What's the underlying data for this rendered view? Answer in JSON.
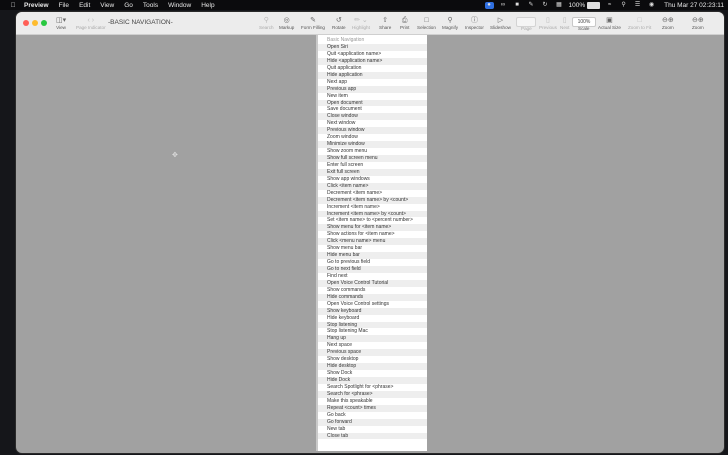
{
  "menubar": {
    "app_name": "Preview",
    "items": [
      "File",
      "Edit",
      "View",
      "Go",
      "Tools",
      "Window",
      "Help"
    ],
    "battery_percent": "100%",
    "datetime": "Thu Mar 27  02:23:11"
  },
  "window": {
    "doc_title": "-BASIC NAVIGATION-",
    "toolbar": {
      "view": "View",
      "page_indicator": "Page Indicator",
      "search": "Search",
      "markup": "Markup",
      "form_filling": "Form Filling",
      "rotate": "Rotate",
      "highlight": "Highlight",
      "share": "Share",
      "print": "Print",
      "selection": "Selection",
      "magnify": "Magnify",
      "inspector": "Inspector",
      "slideshow": "Slideshow",
      "page": "Page",
      "previous": "Previous",
      "next": "Next",
      "scale": "Scale",
      "zoom_value": "100%",
      "actual_size": "Actual Size",
      "zoom_to_fit": "Zoom to Fit",
      "zoom": "Zoom",
      "zoom2": "Zoom"
    }
  },
  "document": {
    "heading": "Basic Navigation",
    "commands": [
      "Open Siri",
      "Quit <application name>",
      "Hide <application name>",
      "Quit application",
      "Hide application",
      "Next app",
      "Previous app",
      "New item",
      "Open document",
      "Save document",
      "Close window",
      "Next window",
      "Previous window",
      "Zoom window",
      "Minimize window",
      "Show zoom menu",
      "Show full screen menu",
      "Enter full screen",
      "Exit full screen",
      "Show app windows",
      "Click <item name>",
      "Decrement <item name>",
      "Decrement <item name> by <count>",
      "Increment <item name>",
      "Increment <item name> by <count>",
      "Set <item name> to <percent number>",
      "Show menu for <item name>",
      "Show actions for <item name>",
      "Click <menu name> menu",
      "Show menu bar",
      "Hide menu bar",
      "Go to previous field",
      "Go to next field",
      "Find next",
      "Open Voice Control Tutorial",
      "Show commands",
      "Hide commands",
      "Open Voice Control settings",
      "Show keyboard",
      "Hide keyboard",
      "Stop listening",
      "Stop listening Mac",
      "Hang up",
      "Next space",
      "Previous space",
      "Show desktop",
      "Hide desktop",
      "Show Dock",
      "Hide Dock",
      "Search Spotlight for <phrase>",
      "Search for <phrase>",
      "Make this speakable",
      "Repeat <count> times",
      "Go back",
      "Go forward",
      "New tab",
      "Close tab"
    ]
  }
}
